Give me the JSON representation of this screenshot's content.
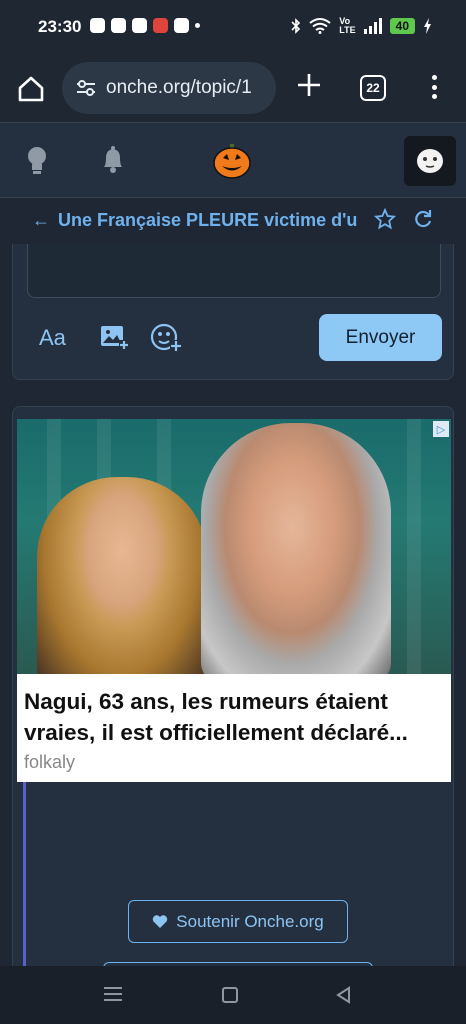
{
  "status_bar": {
    "time": "23:30",
    "network_label": "Vo\nLTE",
    "battery": "40"
  },
  "browser": {
    "url": "onche.org/topic/1",
    "tab_count": "22"
  },
  "topic": {
    "title": "Une Française PLEURE victime d'u"
  },
  "composer": {
    "format_label": "Aa",
    "send_label": "Envoyer"
  },
  "ad": {
    "headline_line1": "Nagui, 63 ans, les rumeurs étaient",
    "headline_line2": "vraies, il est officiellement déclaré...",
    "source": "folkaly"
  },
  "support": {
    "label": "Soutenir Onche.org"
  },
  "colors": {
    "accent": "#6fb1ec",
    "send_button": "#8ec9f6",
    "background": "#1e2733",
    "panel": "#243040"
  }
}
